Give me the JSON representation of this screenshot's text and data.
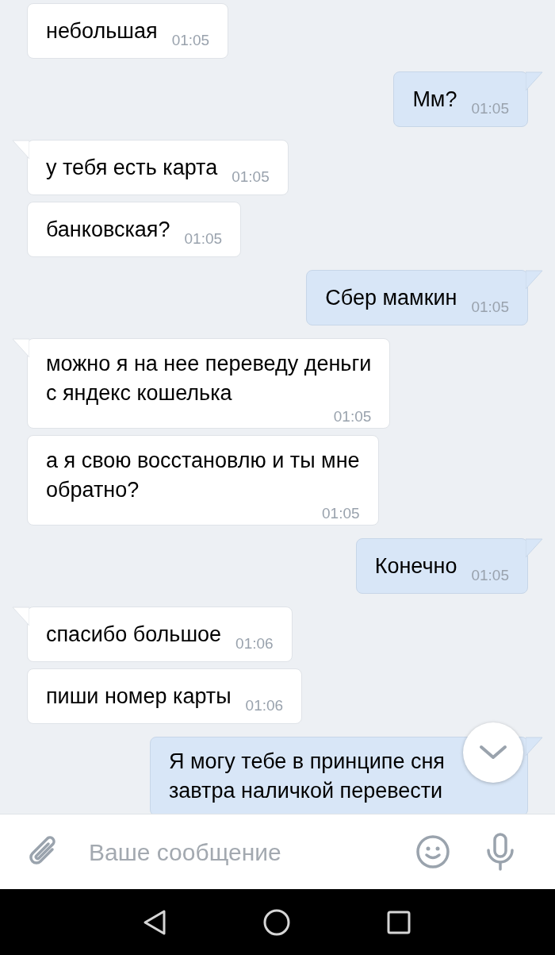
{
  "messages": [
    {
      "kind": "incoming",
      "tail": false,
      "text": "небольшая",
      "time": "01:05"
    },
    {
      "kind": "outgoing",
      "tail": true,
      "text": "Мм?",
      "time": "01:05"
    },
    {
      "kind": "incoming",
      "tail": true,
      "text": "у тебя есть карта",
      "time": "01:05"
    },
    {
      "kind": "incoming",
      "tail": false,
      "text": "банковская?",
      "time": "01:05"
    },
    {
      "kind": "outgoing",
      "tail": true,
      "text": "Сбер мамкин",
      "time": "01:05"
    },
    {
      "kind": "incoming",
      "tail": true,
      "text": "можно я на нее переведу деньги\nс яндекс кошелька",
      "time": "01:05"
    },
    {
      "kind": "incoming",
      "tail": false,
      "text": "а я свою восстановлю и ты мне\nобратно?",
      "time": "01:05"
    },
    {
      "kind": "outgoing",
      "tail": true,
      "text": "Конечно",
      "time": "01:05"
    },
    {
      "kind": "incoming",
      "tail": true,
      "text": "спасибо большое",
      "time": "01:06"
    },
    {
      "kind": "incoming",
      "tail": false,
      "text": "пиши номер карты",
      "time": "01:06"
    },
    {
      "kind": "outgoing",
      "tail": true,
      "text": "Я могу тебе в принципе сня\nзавтра наличкой перевести"
    }
  ],
  "composer": {
    "placeholder": "Ваше сообщение"
  }
}
